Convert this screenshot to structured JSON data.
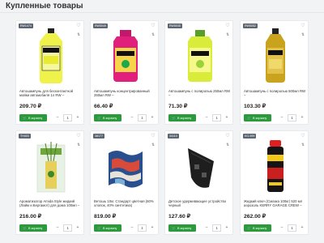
{
  "page": {
    "title": "Купленные товары",
    "buy_label": "В корзину",
    "colors": {
      "buy": "#2a9a3a",
      "sku": "#5b6572"
    }
  },
  "products": [
    {
      "sku": "RW1474",
      "name": "Автошампунь для бесконтактной мойки автомобиля 1л RW –",
      "price": "209.70 ₽",
      "qty": "1"
    },
    {
      "sku": "RW5049",
      "name": "Автошампунь концентрированный 250мл RW –",
      "price": "66.40 ₽",
      "qty": "1"
    },
    {
      "sku": "RW5045",
      "name": "Автошампунь с полиролью 250мл RW –",
      "price": "71.30 ₽",
      "qty": "1"
    },
    {
      "sku": "RW5052",
      "name": "Автошампунь с полиролью 500мл RW –",
      "price": "103.30 ₽",
      "qty": "1"
    },
    {
      "sku": "TH403",
      "name": "Ароматизатор Amida Style жидкий (Лайм и Бергамот) для дома 100мл –",
      "price": "216.00 ₽",
      "qty": "1"
    },
    {
      "sku": "38177",
      "name": "Ветошь 10кг. Стандарт цветная (60% хлопок, 40% синтетика)",
      "price": "819.00 ₽",
      "qty": "1"
    },
    {
      "sku": "34110",
      "name": "Детское удерживающее устройство черный",
      "price": "127.60 ₽",
      "qty": "1"
    },
    {
      "sku": "KG-999",
      "name": "Жидкий ключ (Смазка 100кг) 520 мл аэрозоль KERRY GARAGE CREW –",
      "price": "262.00 ₽",
      "qty": "1"
    }
  ]
}
